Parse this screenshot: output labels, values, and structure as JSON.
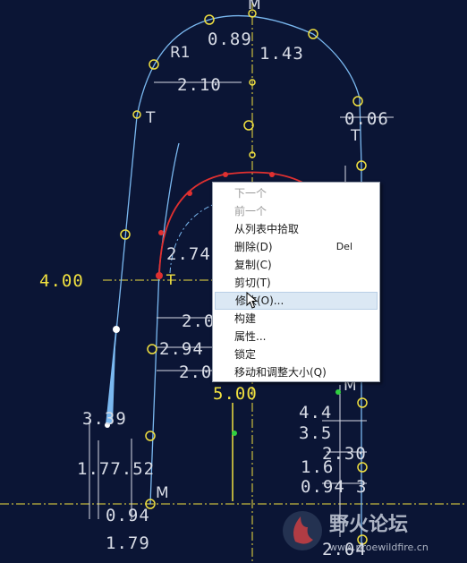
{
  "sketch": {
    "dimensions": [
      "0.89",
      "1.43",
      "2.10",
      "0.06",
      "2.74",
      "2.0",
      "2.94",
      "2.0",
      "3.39",
      "1.77.52",
      "0.94",
      "1.79",
      "4.4",
      "3.5",
      "2.30",
      "1.6",
      "0.94",
      "3",
      "2.04"
    ],
    "highlighted_dimensions": [
      "4.00",
      "5.00"
    ],
    "constraint_labels": [
      "M",
      "R1",
      "T",
      "T",
      "T",
      "M",
      "M"
    ],
    "colors": {
      "background": "#0b1535",
      "geometry": "#7ab8f0",
      "selected": "#e03030",
      "dimension": "#d8dce6",
      "highlight": "#f0e040",
      "point": "#f0e040"
    }
  },
  "context_menu": {
    "items": [
      {
        "label": "下一个",
        "enabled": false
      },
      {
        "label": "前一个",
        "enabled": false
      },
      {
        "label": "从列表中拾取",
        "enabled": true
      },
      {
        "label": "删除(D)",
        "enabled": true,
        "shortcut": "Del"
      },
      {
        "label": "复制(C)",
        "enabled": true
      },
      {
        "label": "剪切(T)",
        "enabled": true
      },
      {
        "label": "修改(O)...",
        "enabled": true,
        "hovered": true
      },
      {
        "label": "构建",
        "enabled": true
      },
      {
        "label": "属性...",
        "enabled": true
      },
      {
        "label": "锁定",
        "enabled": true
      },
      {
        "label": "移动和调整大小(Q)",
        "enabled": true
      }
    ]
  },
  "watermark": {
    "title": "野火论坛",
    "url": "www.proewildfire.cn"
  }
}
